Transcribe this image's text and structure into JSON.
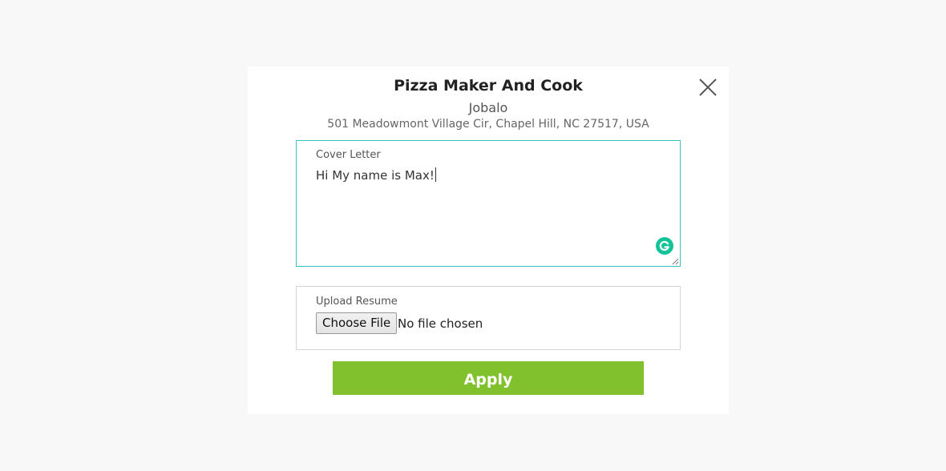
{
  "job": {
    "title": "Pizza Maker And Cook",
    "company": "Jobalo",
    "address": "501 Meadowmont Village Cir, Chapel Hill, NC 27517, USA"
  },
  "cover_letter": {
    "label": "Cover Letter",
    "value": "Hi My name is Max!"
  },
  "upload": {
    "label": "Upload Resume",
    "button_label": "Choose File",
    "status": "No file chosen"
  },
  "apply_label": "Apply",
  "icons": {
    "close": "close-icon",
    "grammarly": "grammarly-icon",
    "resize": "resize-handle-icon"
  },
  "colors": {
    "apply": "#82c12e",
    "focus_border": "#36c2c2",
    "grammarly": "#15c39a"
  }
}
